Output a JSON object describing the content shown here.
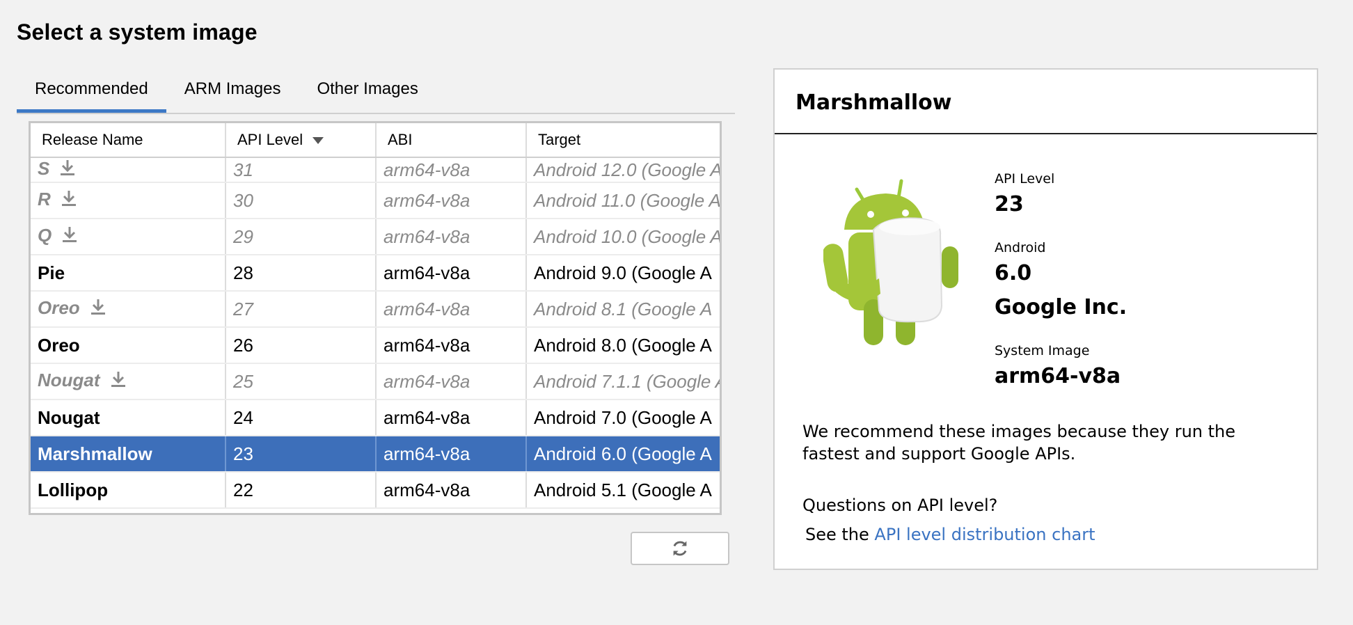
{
  "page": {
    "title": "Select a system image"
  },
  "tabs": [
    {
      "label": "Recommended",
      "active": true
    },
    {
      "label": "ARM Images",
      "active": false
    },
    {
      "label": "Other Images",
      "active": false
    }
  ],
  "table": {
    "columns": [
      "Release Name",
      "API Level",
      "ABI",
      "Target"
    ],
    "sort_column": "API Level",
    "rows": [
      {
        "name": "S",
        "api": "31",
        "abi": "arm64-v8a",
        "target": "Android 12.0 (Google A",
        "downloadable": true
      },
      {
        "name": "R",
        "api": "30",
        "abi": "arm64-v8a",
        "target": "Android 11.0 (Google A",
        "downloadable": true
      },
      {
        "name": "Q",
        "api": "29",
        "abi": "arm64-v8a",
        "target": "Android 10.0 (Google A",
        "downloadable": true
      },
      {
        "name": "Pie",
        "api": "28",
        "abi": "arm64-v8a",
        "target": "Android 9.0 (Google A",
        "downloadable": false
      },
      {
        "name": "Oreo",
        "api": "27",
        "abi": "arm64-v8a",
        "target": "Android 8.1 (Google A",
        "downloadable": true
      },
      {
        "name": "Oreo",
        "api": "26",
        "abi": "arm64-v8a",
        "target": "Android 8.0 (Google A",
        "downloadable": false
      },
      {
        "name": "Nougat",
        "api": "25",
        "abi": "arm64-v8a",
        "target": "Android 7.1.1 (Google A",
        "downloadable": true
      },
      {
        "name": "Nougat",
        "api": "24",
        "abi": "arm64-v8a",
        "target": "Android 7.0 (Google A",
        "downloadable": false
      },
      {
        "name": "Marshmallow",
        "api": "23",
        "abi": "arm64-v8a",
        "target": "Android 6.0 (Google A",
        "downloadable": false,
        "selected": true
      },
      {
        "name": "Lollipop",
        "api": "22",
        "abi": "arm64-v8a",
        "target": "Android 5.1 (Google A",
        "downloadable": false
      }
    ]
  },
  "refresh": {
    "icon": "refresh-icon"
  },
  "detail": {
    "title": "Marshmallow",
    "api_label": "API Level",
    "api_value": "23",
    "android_label": "Android",
    "android_version": "6.0",
    "vendor": "Google Inc.",
    "system_image_label": "System Image",
    "system_image_value": "arm64-v8a",
    "description": "We recommend these images because they run the fastest and support Google APIs.",
    "question": "Questions on API level?",
    "see_prefix": "See the ",
    "link_text": "API level distribution chart"
  },
  "colors": {
    "accent": "#3d79c6",
    "selection": "#3d6fba",
    "link": "#3a73c2",
    "android_green": "#a4c639"
  }
}
